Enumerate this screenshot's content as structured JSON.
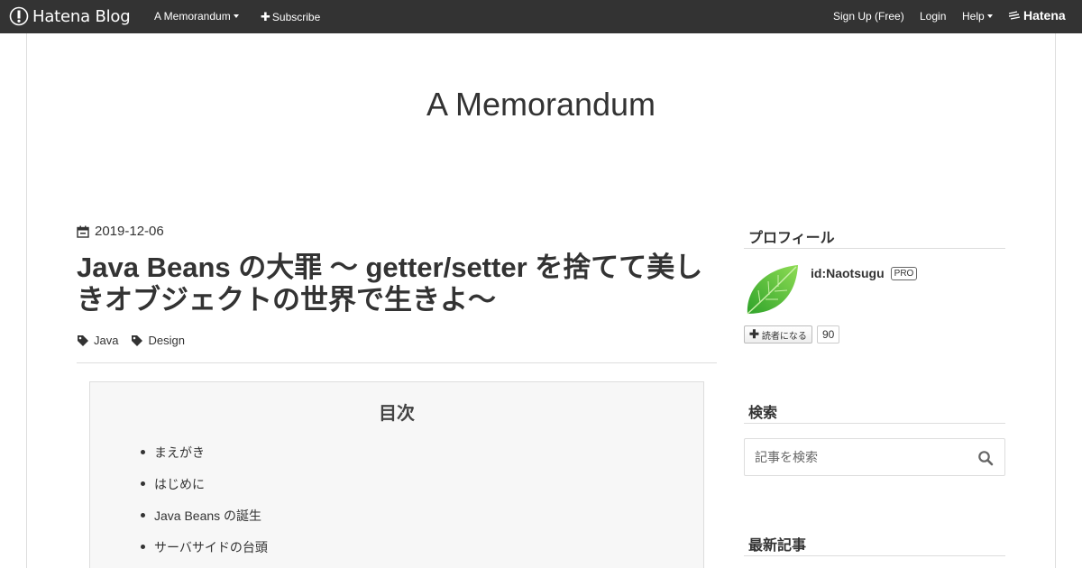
{
  "header": {
    "logo_text": "Hatena Blog",
    "blog_menu": "A Memorandum",
    "subscribe": "Subscribe",
    "signup": "Sign Up (Free)",
    "login": "Login",
    "help": "Help",
    "brand": "Hatena"
  },
  "blog": {
    "title": "A Memorandum"
  },
  "article": {
    "date": "2019-12-06",
    "title": "Java Beans の大罪 〜 getter/setter を捨てて美しきオブジェクトの世界で生きよ〜",
    "categories": [
      "Java",
      "Design"
    ]
  },
  "toc": {
    "heading": "目次",
    "items": [
      "まえがき",
      "はじめに",
      "Java Beans の誕生",
      "サーバサイドの台頭"
    ]
  },
  "sidebar": {
    "profile_heading": "プロフィール",
    "profile_id": "id:Naotsugu",
    "pro_badge": "PRO",
    "subscribe_label": "読者になる",
    "subscriber_count": "90",
    "search_heading": "検索",
    "search_placeholder": "記事を検索",
    "recent_heading": "最新記事"
  },
  "icons": {
    "date": "calendar-icon",
    "category": "tag-icon",
    "search": "search-icon",
    "profile": "leaf-avatar-icon"
  },
  "colors": {
    "header_bg": "#333333",
    "text": "#333333",
    "border": "#dddddd",
    "toc_bg": "#f7f7f7"
  }
}
